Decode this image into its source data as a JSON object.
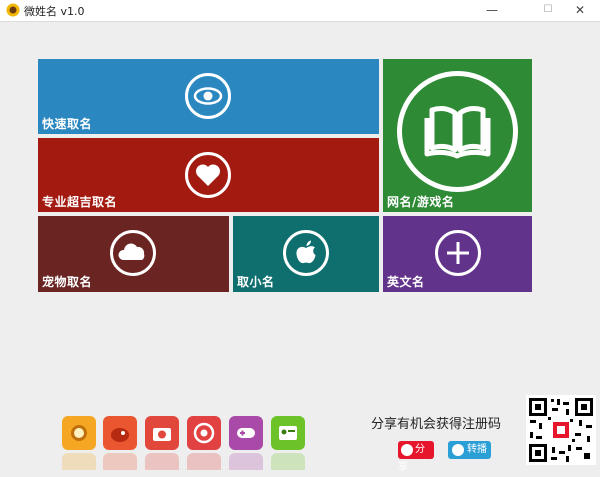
{
  "window": {
    "title": "微姓名 v1.0",
    "minimize": "—",
    "maximize": "☐",
    "close": "✕"
  },
  "tiles": {
    "quick": {
      "label": "快速取名",
      "icon": "eye-icon",
      "color": "#2a87c0"
    },
    "pro": {
      "label": "专业超吉取名",
      "icon": "heart-icon",
      "color": "#a31b10"
    },
    "game": {
      "label": "网名/游戏名",
      "icon": "book-icon",
      "color": "#2f8a36"
    },
    "pet": {
      "label": "宠物取名",
      "icon": "cloud-icon",
      "color": "#6a2522"
    },
    "nickname": {
      "label": "取小名",
      "icon": "apple-icon",
      "color": "#0f6e6e"
    },
    "english": {
      "label": "英文名",
      "icon": "plus-icon",
      "color": "#62338a"
    }
  },
  "bottom_apps": [
    {
      "name": "sun-app-icon",
      "color": "#f5a623"
    },
    {
      "name": "bird-app-icon",
      "color": "#e9562f"
    },
    {
      "name": "camera-app-icon",
      "color": "#e2473b"
    },
    {
      "name": "chrome-app-icon",
      "color": "#e24141"
    },
    {
      "name": "gamepad-app-icon",
      "color": "#a94aa8"
    },
    {
      "name": "contact-card-app-icon",
      "color": "#6cc229"
    }
  ],
  "share": {
    "text": "分享有机会获得注册码",
    "weibo_label": "分享",
    "wechat_label": "转播"
  }
}
